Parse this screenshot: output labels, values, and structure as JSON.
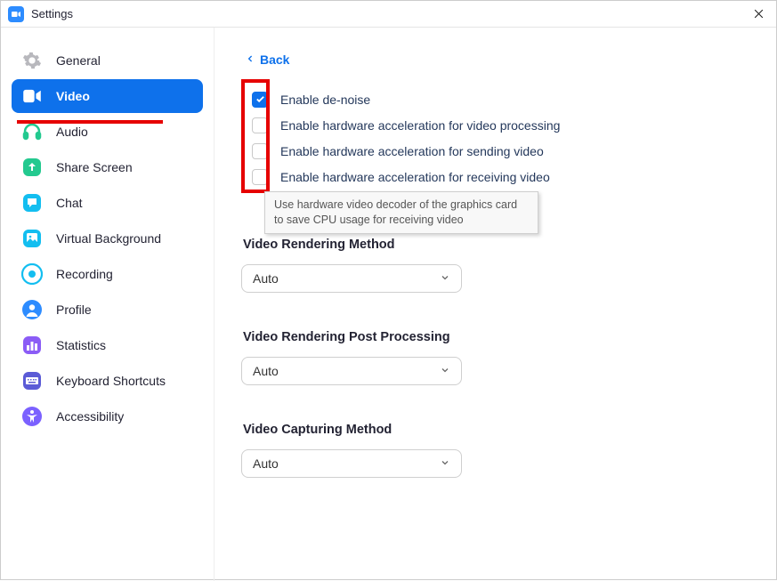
{
  "window": {
    "title": "Settings"
  },
  "sidebar": {
    "items": [
      {
        "label": "General",
        "icon": "gear"
      },
      {
        "label": "Video",
        "icon": "video"
      },
      {
        "label": "Audio",
        "icon": "headphones"
      },
      {
        "label": "Share Screen",
        "icon": "arrow-up-box"
      },
      {
        "label": "Chat",
        "icon": "speech"
      },
      {
        "label": "Virtual Background",
        "icon": "image"
      },
      {
        "label": "Recording",
        "icon": "record"
      },
      {
        "label": "Profile",
        "icon": "person"
      },
      {
        "label": "Statistics",
        "icon": "bar-chart"
      },
      {
        "label": "Keyboard Shortcuts",
        "icon": "keyboard"
      },
      {
        "label": "Accessibility",
        "icon": "accessibility"
      }
    ],
    "active_index": 1
  },
  "content": {
    "back_label": "Back",
    "options": [
      {
        "label": "Enable de-noise",
        "checked": true
      },
      {
        "label": "Enable hardware acceleration for video processing",
        "checked": false
      },
      {
        "label": "Enable hardware acceleration for sending video",
        "checked": false
      },
      {
        "label": "Enable hardware acceleration for receiving video",
        "checked": false
      }
    ],
    "tooltip": "Use hardware video decoder of the graphics card to save CPU usage for receiving video",
    "sections": [
      {
        "title": "Video Rendering Method",
        "value": "Auto"
      },
      {
        "title": "Video Rendering Post Processing",
        "value": "Auto"
      },
      {
        "title": "Video Capturing Method",
        "value": "Auto"
      }
    ]
  },
  "annotation": {
    "red_box_on_checkboxes": true,
    "red_underline_on_video": true
  },
  "icon_colors": {
    "gear": "#b8b8bd",
    "video": "#ffffff",
    "headphones": "#23c98f",
    "arrow-up-box": "#23c98f",
    "speech": "#13bef0",
    "image": "#13bef0",
    "record": "#13bef0",
    "person": "#2D8CFF",
    "bar-chart": "#8b5cf6",
    "keyboard": "#5b5bd6",
    "accessibility": "#7b61ff"
  }
}
